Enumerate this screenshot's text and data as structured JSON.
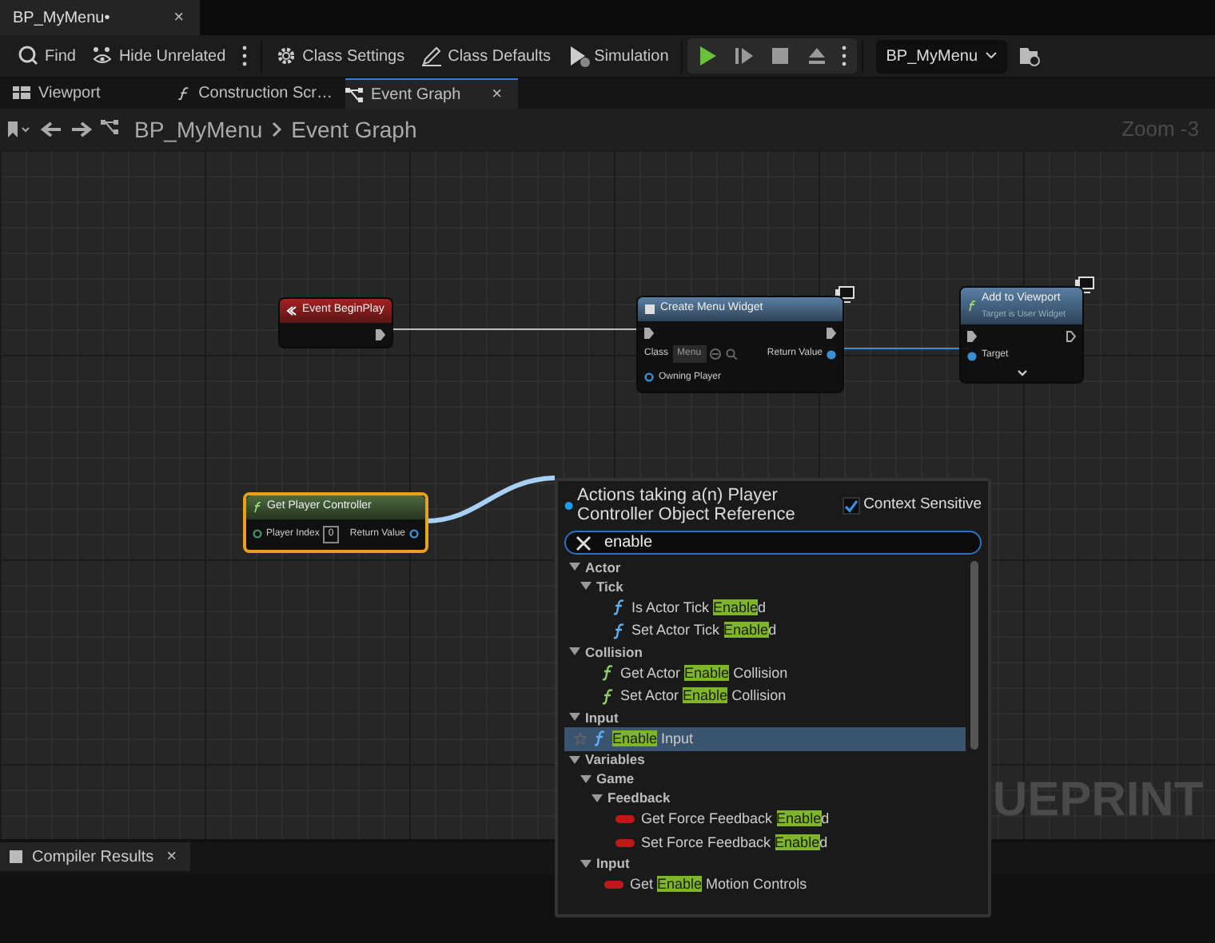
{
  "document_tab": {
    "title": "BP_MyMenu•",
    "close": "×"
  },
  "toolbar": {
    "buttons": [
      {
        "kind": "find",
        "label": "Find"
      },
      {
        "kind": "hide",
        "label": "Hide Unrelated"
      },
      {
        "kind": "more"
      },
      {
        "kind": "settings",
        "label": "Class Settings"
      },
      {
        "kind": "defaults",
        "label": "Class Defaults"
      },
      {
        "kind": "simulation",
        "label": "Simulation"
      }
    ],
    "play_controls": [
      {
        "kind": "play"
      },
      {
        "kind": "step"
      },
      {
        "kind": "stop"
      },
      {
        "kind": "eject"
      },
      {
        "kind": "more"
      }
    ],
    "debug_object": "BP_MyMenu"
  },
  "graph_tabs": [
    {
      "kind": "viewport",
      "label": "Viewport",
      "selected": false
    },
    {
      "kind": "function",
      "label": "Construction Scr…",
      "selected": false
    },
    {
      "kind": "graph",
      "label": "Event Graph",
      "selected": true,
      "close": "×"
    }
  ],
  "breadcrumb": [
    "BP_MyMenu",
    "Event Graph"
  ],
  "zoom": "Zoom -3",
  "watermark": "UEPRINT",
  "nodes": [
    {
      "kind": "event",
      "title": "Event BeginPlay",
      "selected": false
    },
    {
      "kind": "widget",
      "title": "Create Menu Widget",
      "selected": false,
      "class_label": "Class",
      "class_value": "Menu",
      "return": "Return Value",
      "input": "Owning Player"
    },
    {
      "kind": "call",
      "title": "Add to Viewport",
      "subtitle": "Target is User Widget",
      "selected": false,
      "input": "Target"
    },
    {
      "kind": "pure",
      "title": "Get Player Controller",
      "selected": true,
      "input": "Player Index",
      "input_value": "0",
      "return": "Return Value"
    }
  ],
  "action_menu": {
    "title": "Actions taking a(n) Player Controller Object Reference",
    "context_sensitive": {
      "label": "Context Sensitive",
      "checked": true
    },
    "search": "enable",
    "tree": [
      {
        "label": "Actor",
        "expanded": true,
        "children": [
          {
            "label": "Tick",
            "expanded": true,
            "children": [
              {
                "kind": "function",
                "before": "Is Actor Tick ",
                "match": "Enable",
                "after": "d",
                "selected": false
              },
              {
                "kind": "function",
                "before": "Set Actor Tick ",
                "match": "Enable",
                "after": "d",
                "selected": false
              }
            ]
          }
        ]
      },
      {
        "label": "Collision",
        "expanded": true,
        "children": [
          {
            "kind": "function",
            "before": "Get Actor ",
            "match": "Enable",
            "after": " Collision",
            "selected": false
          },
          {
            "kind": "function",
            "before": "Set Actor ",
            "match": "Enable",
            "after": " Collision",
            "selected": false
          }
        ]
      },
      {
        "label": "Input",
        "expanded": true,
        "children": [
          {
            "kind": "function",
            "match": "Enable",
            "after": " Input",
            "selected": true
          }
        ]
      },
      {
        "label": "Variables",
        "expanded": true,
        "children": [
          {
            "label": "Game",
            "expanded": true,
            "children": [
              {
                "label": "Feedback",
                "expanded": true,
                "children": [
                  {
                    "kind": "variable",
                    "before": "Get Force Feedback ",
                    "match": "Enable",
                    "after": "d",
                    "selected": false
                  },
                  {
                    "kind": "variable",
                    "before": "Set Force Feedback ",
                    "match": "Enable",
                    "after": "d",
                    "selected": false
                  }
                ]
              }
            ]
          },
          {
            "label": "Input",
            "expanded": true,
            "children": [
              {
                "kind": "variable",
                "before": "Get ",
                "match": "Enable",
                "after": " Motion Controls",
                "selected": false
              }
            ]
          }
        ]
      }
    ]
  },
  "bottom_tabs": [
    {
      "label": "Compiler Results",
      "close": "×"
    }
  ]
}
